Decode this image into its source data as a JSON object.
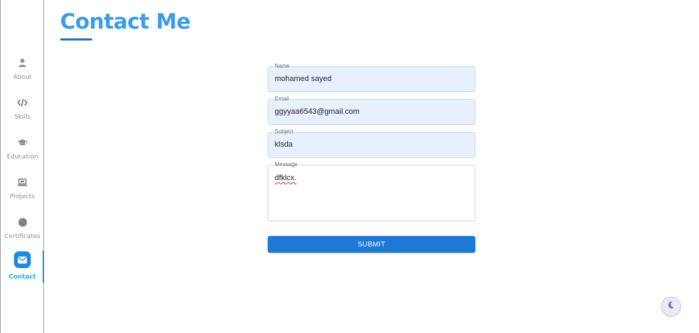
{
  "page": {
    "title": "Contact Me"
  },
  "sidebar": {
    "items": [
      {
        "label": "About",
        "icon": "person-icon"
      },
      {
        "label": "Skills",
        "icon": "code-icon"
      },
      {
        "label": "Education",
        "icon": "graduation-cap-icon"
      },
      {
        "label": "Projects",
        "icon": "laptop-icon"
      },
      {
        "label": "Certificates",
        "icon": "certificate-icon"
      },
      {
        "label": "Contact",
        "icon": "envelope-icon",
        "active": true
      }
    ]
  },
  "form": {
    "name": {
      "label": "Name",
      "value": "mohamed sayed"
    },
    "email": {
      "label": "Email",
      "value": "ggyyaa6543@gmail.com"
    },
    "subject": {
      "label": "Subject",
      "value": "klsda"
    },
    "message": {
      "label": "Message",
      "value": "dfklcx."
    },
    "submit_label": "SUBMIT"
  },
  "theme_toggle": {
    "icon": "moon-icon"
  },
  "colors": {
    "accent": "#1e88e5",
    "title": "#3b9ce8",
    "active_label": "#16b4e6"
  }
}
